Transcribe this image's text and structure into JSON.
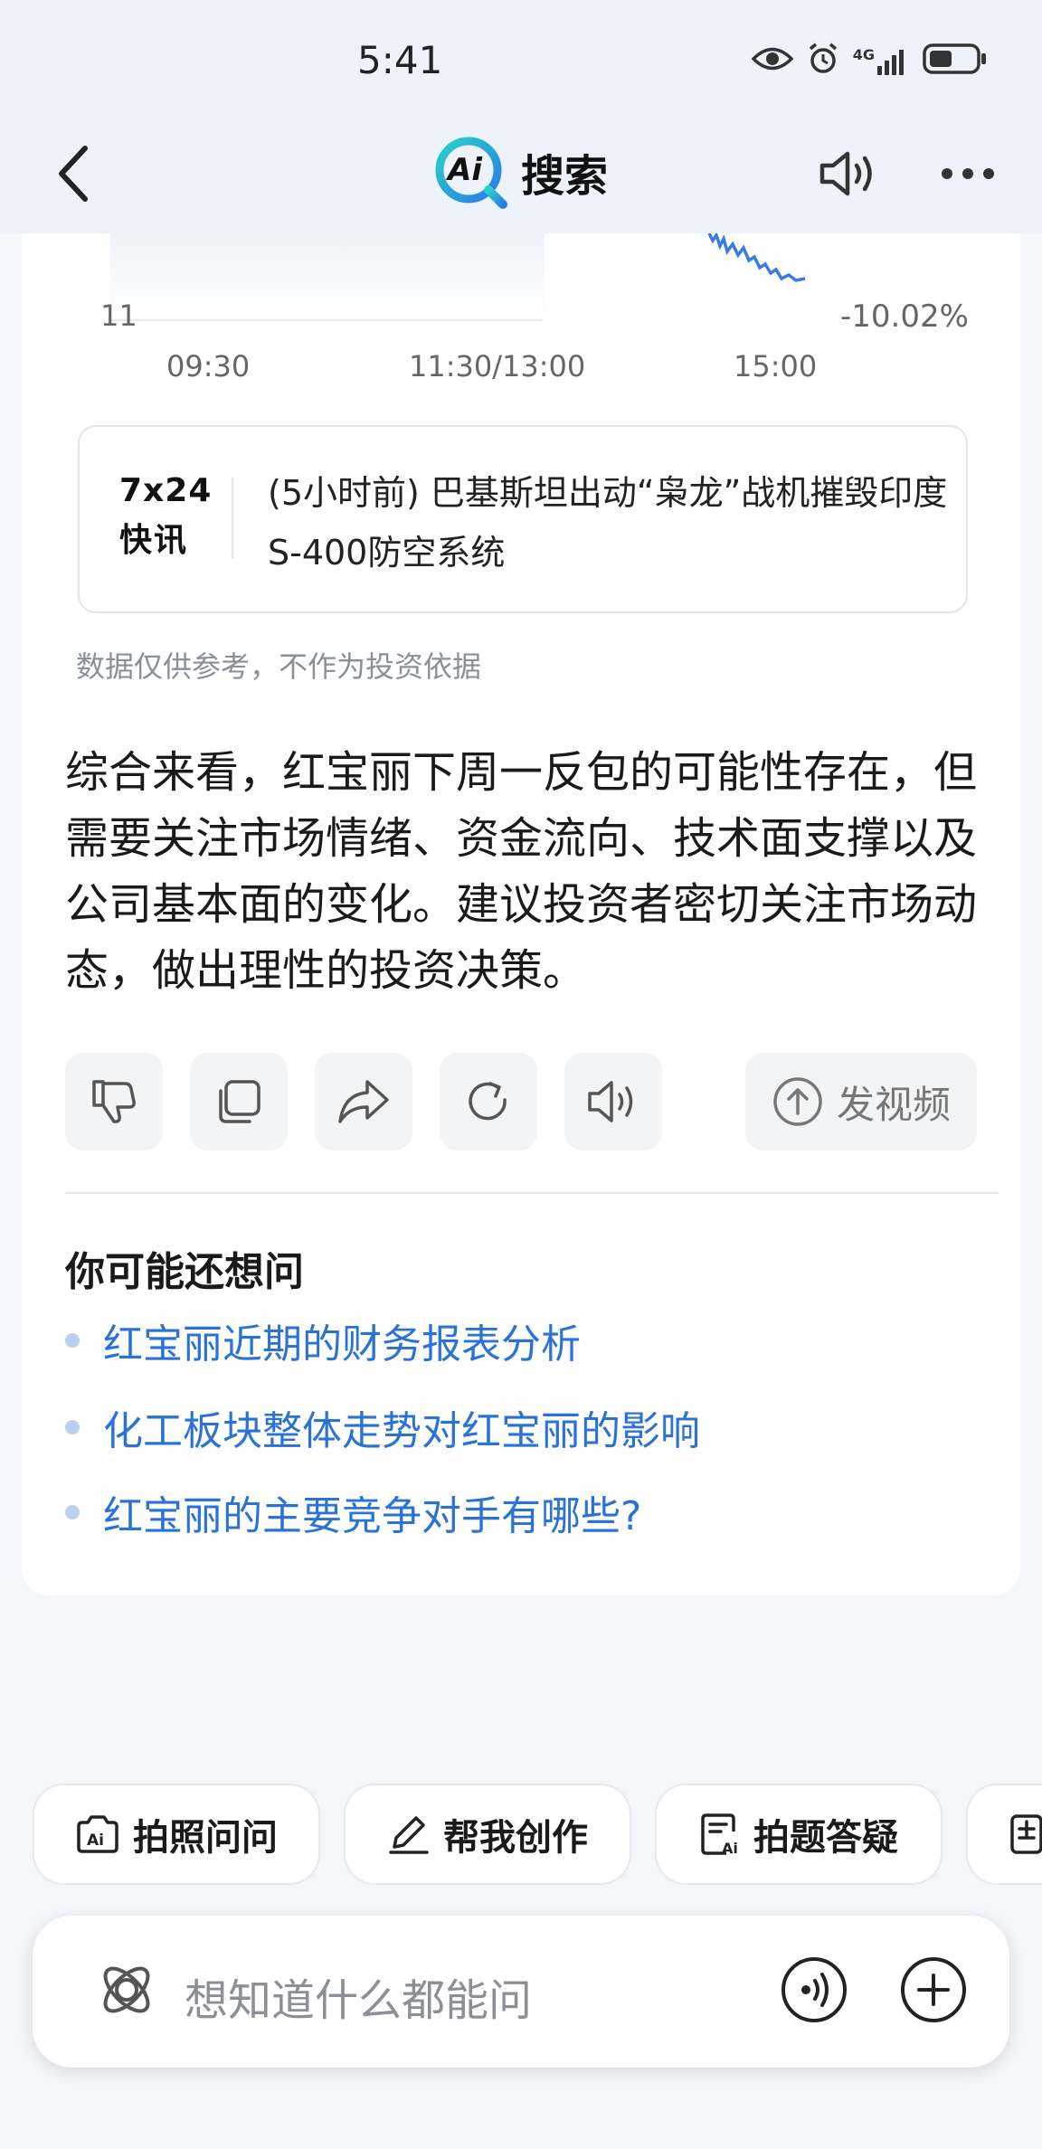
{
  "status_bar": {
    "time": "5:41",
    "network": "4G"
  },
  "header": {
    "logo_text": "Ai",
    "title": "搜索"
  },
  "chart": {
    "y_label": "11",
    "right_label": "-10.02%",
    "x_ticks": [
      "09:30",
      "11:30/13:00",
      "15:00"
    ]
  },
  "news": {
    "badge_line1": "7x24",
    "badge_line2": "快讯",
    "text": "(5小时前) 巴基斯坦出动“枭龙”战机摧毁印度S-400防空系统"
  },
  "disclaimer": "数据仅供参考，不作为投资依据",
  "summary": "综合来看，红宝丽下周一反包的可能性存在，但需要关注市场情绪、资金流向、技术面支撑以及公司基本面的变化。建议投资者密切关注市场动态，做出理性的投资决策。",
  "actions": {
    "video_label": "发视频"
  },
  "suggestions": {
    "heading": "你可能还想问",
    "items": [
      "红宝丽近期的财务报表分析",
      "化工板块整体走势对红宝丽的影响",
      "红宝丽的主要竞争对手有哪些?"
    ]
  },
  "tools": [
    "拍照问问",
    "帮我创作",
    "拍题答疑"
  ],
  "input": {
    "placeholder": "想知道什么都能问"
  },
  "colors": {
    "accent": "#2b72d6",
    "chart_line": "#3b7ae0",
    "background": "#f4f6fa"
  }
}
